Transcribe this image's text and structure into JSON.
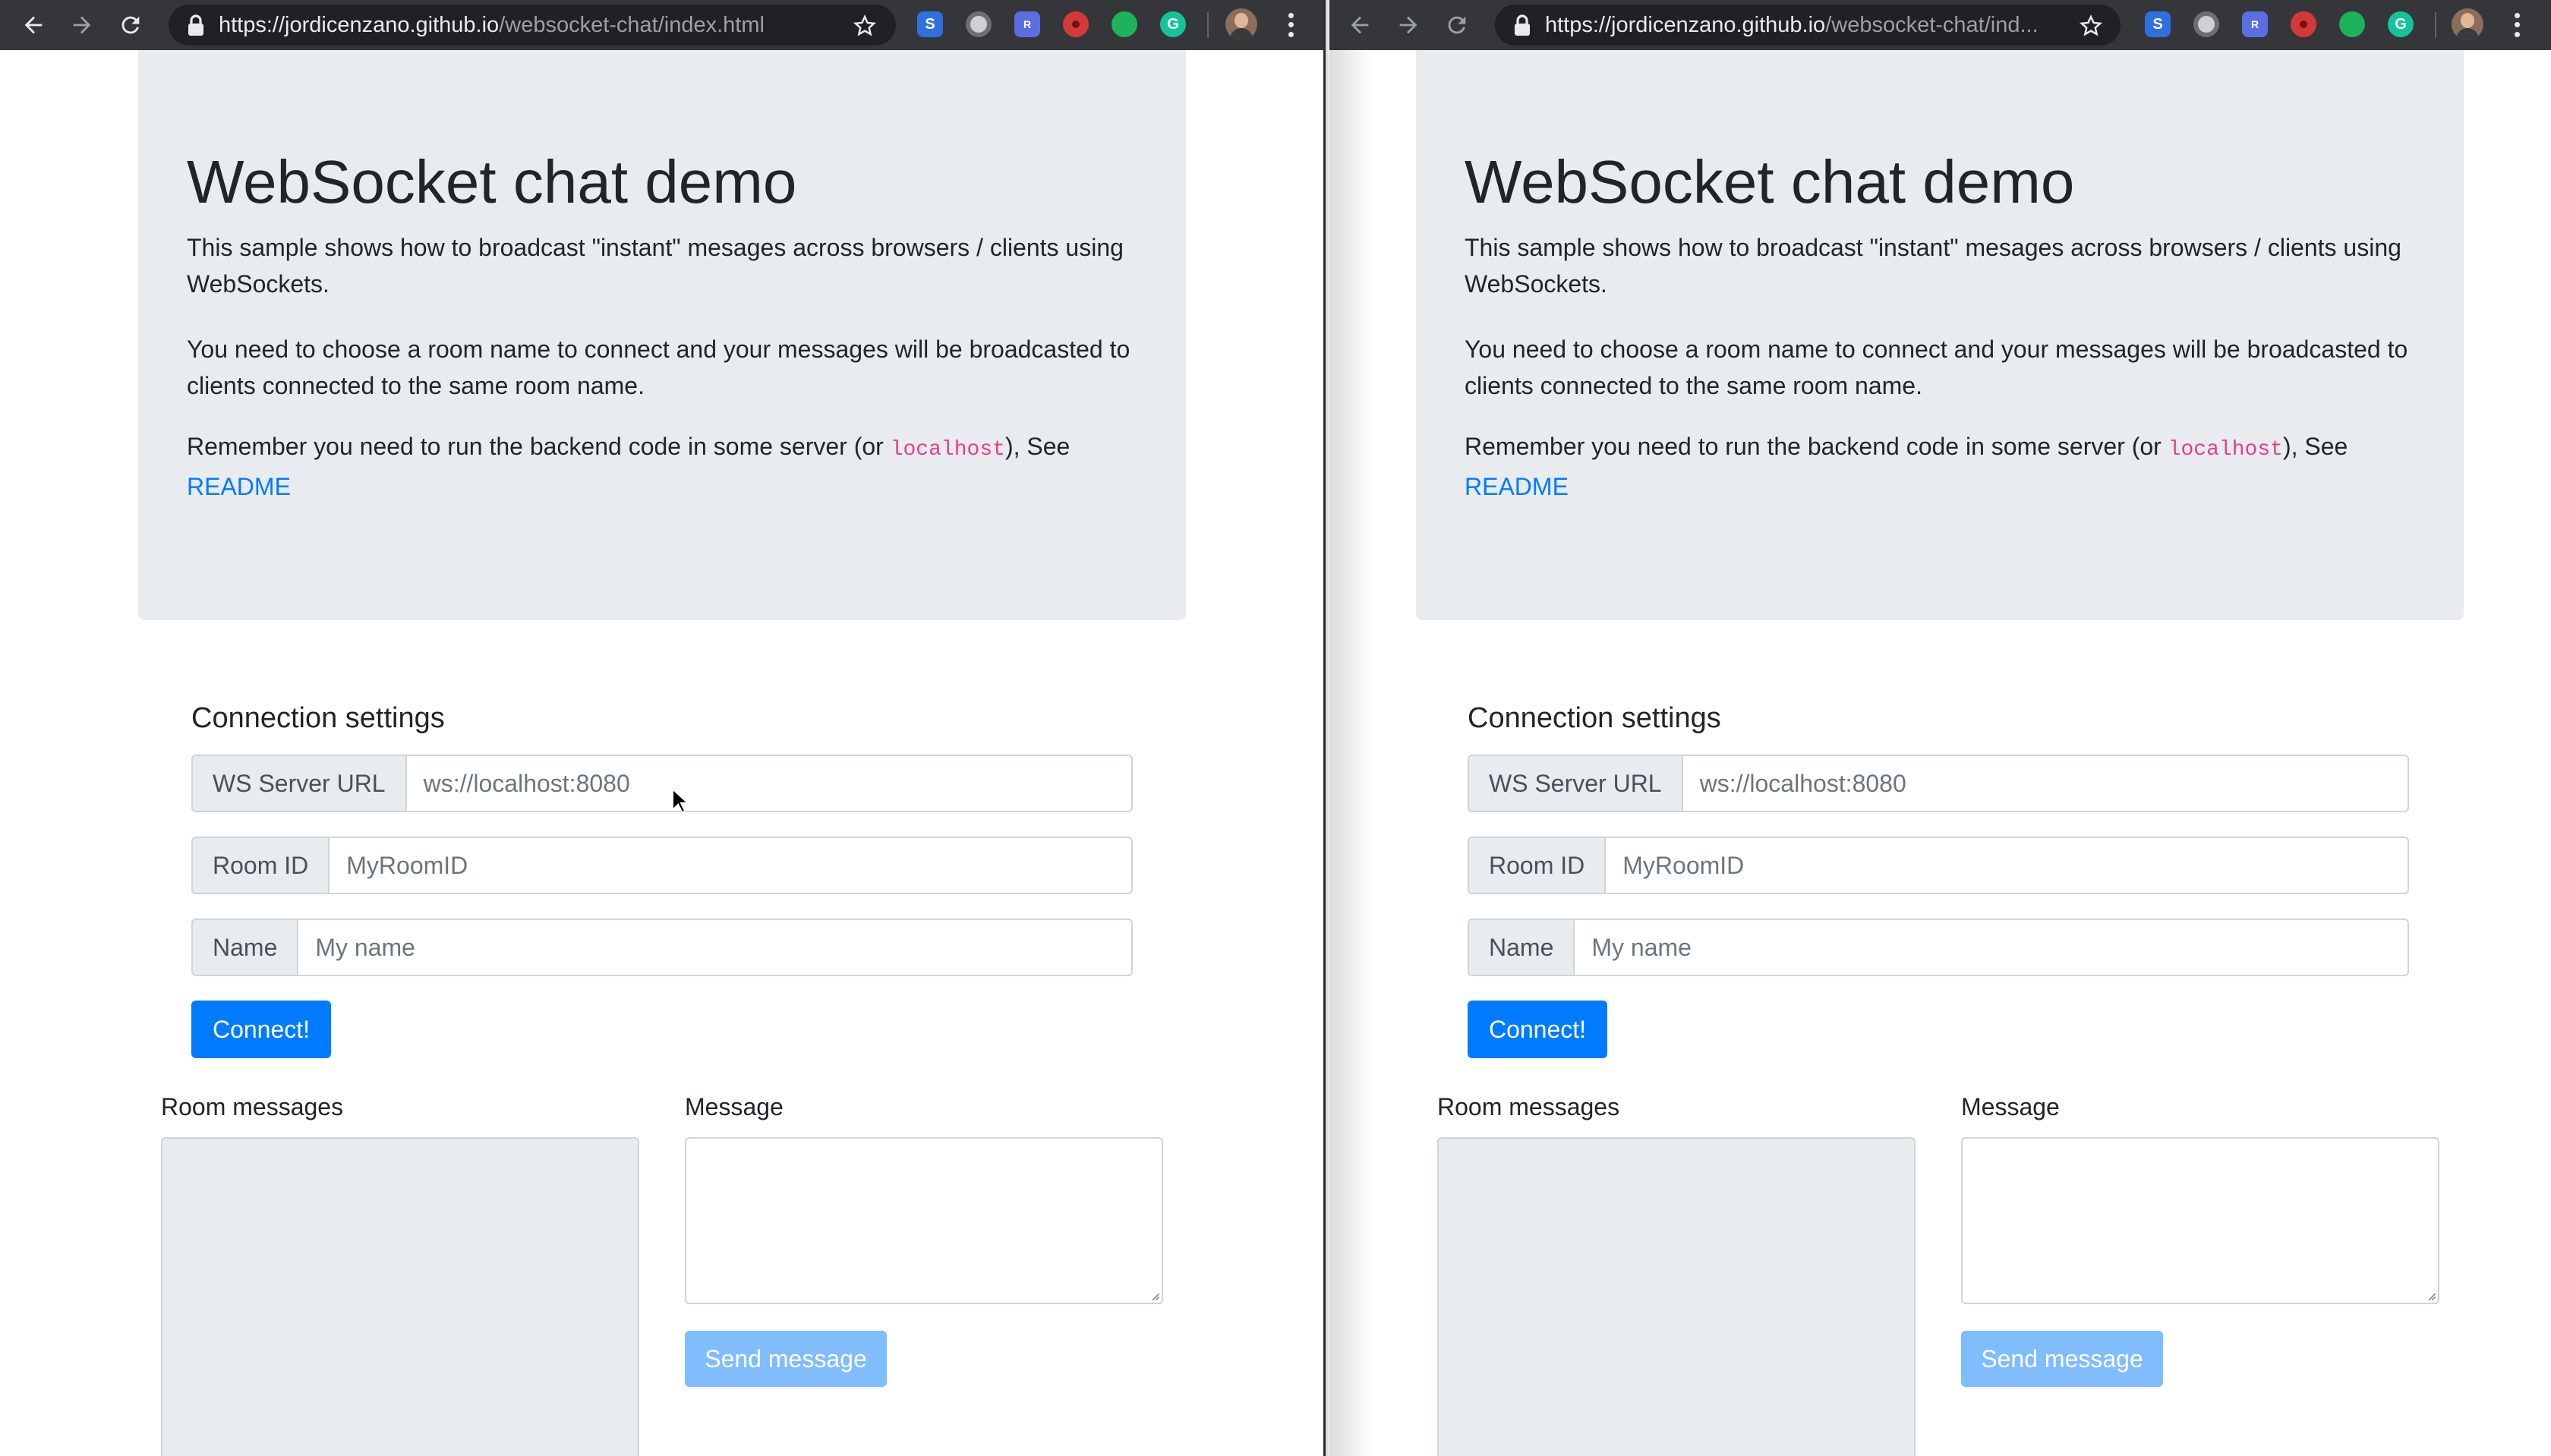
{
  "left_window": {
    "toolbar": {
      "url_host": "https://jordicenzano.github.io",
      "url_path": "/websocket-chat/index.html"
    }
  },
  "right_window": {
    "toolbar": {
      "url_host": "https://jordicenzano.github.io",
      "url_path": "/websocket-chat/ind..."
    }
  },
  "page": {
    "title": "WebSocket chat demo",
    "intro_1": "This sample shows how to broadcast \"instant\" mesages across browsers / clients using WebSockets.",
    "intro_2": "You need to choose a room name to connect and your messages will be broadcasted to clients connected to the same room name.",
    "intro_3_before": "Remember you need to run the backend code in some server (or ",
    "intro_3_code": "localhost",
    "intro_3_after": "), See",
    "readme_link": "README",
    "connection_heading": "Connection settings",
    "ws_label": "WS Server URL",
    "ws_placeholder": "ws://localhost:8080",
    "room_label": "Room ID",
    "room_placeholder": "MyRoomID",
    "name_label": "Name",
    "name_placeholder": "My name",
    "connect_button": "Connect!",
    "room_messages_label": "Room messages",
    "message_label": "Message",
    "send_button": "Send message"
  },
  "colors": {
    "primary": "#007bff",
    "primary_disabled": "#80bdff",
    "jumbotron": "#e9ecef",
    "code": "#e83e8c",
    "toolbar": "#35363a"
  },
  "icons": {
    "toolbar": [
      "back-arrow-icon",
      "forward-arrow-icon",
      "reload-icon",
      "lock-icon",
      "star-icon",
      "extension-icons",
      "profile-avatar",
      "kebab-menu-icon"
    ],
    "cursor": "mouse-pointer"
  }
}
